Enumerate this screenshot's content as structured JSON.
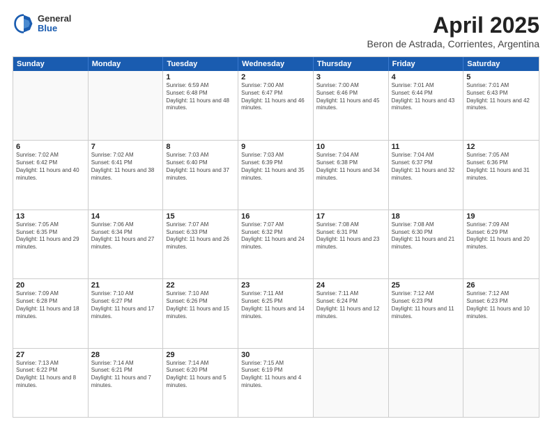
{
  "header": {
    "logo": {
      "general": "General",
      "blue": "Blue"
    },
    "title": "April 2025",
    "location": "Beron de Astrada, Corrientes, Argentina"
  },
  "calendar": {
    "days_of_week": [
      "Sunday",
      "Monday",
      "Tuesday",
      "Wednesday",
      "Thursday",
      "Friday",
      "Saturday"
    ],
    "weeks": [
      [
        {
          "day": "",
          "empty": true
        },
        {
          "day": "",
          "empty": true
        },
        {
          "day": "1",
          "sunrise": "Sunrise: 6:59 AM",
          "sunset": "Sunset: 6:48 PM",
          "daylight": "Daylight: 11 hours and 48 minutes."
        },
        {
          "day": "2",
          "sunrise": "Sunrise: 7:00 AM",
          "sunset": "Sunset: 6:47 PM",
          "daylight": "Daylight: 11 hours and 46 minutes."
        },
        {
          "day": "3",
          "sunrise": "Sunrise: 7:00 AM",
          "sunset": "Sunset: 6:46 PM",
          "daylight": "Daylight: 11 hours and 45 minutes."
        },
        {
          "day": "4",
          "sunrise": "Sunrise: 7:01 AM",
          "sunset": "Sunset: 6:44 PM",
          "daylight": "Daylight: 11 hours and 43 minutes."
        },
        {
          "day": "5",
          "sunrise": "Sunrise: 7:01 AM",
          "sunset": "Sunset: 6:43 PM",
          "daylight": "Daylight: 11 hours and 42 minutes."
        }
      ],
      [
        {
          "day": "6",
          "sunrise": "Sunrise: 7:02 AM",
          "sunset": "Sunset: 6:42 PM",
          "daylight": "Daylight: 11 hours and 40 minutes."
        },
        {
          "day": "7",
          "sunrise": "Sunrise: 7:02 AM",
          "sunset": "Sunset: 6:41 PM",
          "daylight": "Daylight: 11 hours and 38 minutes."
        },
        {
          "day": "8",
          "sunrise": "Sunrise: 7:03 AM",
          "sunset": "Sunset: 6:40 PM",
          "daylight": "Daylight: 11 hours and 37 minutes."
        },
        {
          "day": "9",
          "sunrise": "Sunrise: 7:03 AM",
          "sunset": "Sunset: 6:39 PM",
          "daylight": "Daylight: 11 hours and 35 minutes."
        },
        {
          "day": "10",
          "sunrise": "Sunrise: 7:04 AM",
          "sunset": "Sunset: 6:38 PM",
          "daylight": "Daylight: 11 hours and 34 minutes."
        },
        {
          "day": "11",
          "sunrise": "Sunrise: 7:04 AM",
          "sunset": "Sunset: 6:37 PM",
          "daylight": "Daylight: 11 hours and 32 minutes."
        },
        {
          "day": "12",
          "sunrise": "Sunrise: 7:05 AM",
          "sunset": "Sunset: 6:36 PM",
          "daylight": "Daylight: 11 hours and 31 minutes."
        }
      ],
      [
        {
          "day": "13",
          "sunrise": "Sunrise: 7:05 AM",
          "sunset": "Sunset: 6:35 PM",
          "daylight": "Daylight: 11 hours and 29 minutes."
        },
        {
          "day": "14",
          "sunrise": "Sunrise: 7:06 AM",
          "sunset": "Sunset: 6:34 PM",
          "daylight": "Daylight: 11 hours and 27 minutes."
        },
        {
          "day": "15",
          "sunrise": "Sunrise: 7:07 AM",
          "sunset": "Sunset: 6:33 PM",
          "daylight": "Daylight: 11 hours and 26 minutes."
        },
        {
          "day": "16",
          "sunrise": "Sunrise: 7:07 AM",
          "sunset": "Sunset: 6:32 PM",
          "daylight": "Daylight: 11 hours and 24 minutes."
        },
        {
          "day": "17",
          "sunrise": "Sunrise: 7:08 AM",
          "sunset": "Sunset: 6:31 PM",
          "daylight": "Daylight: 11 hours and 23 minutes."
        },
        {
          "day": "18",
          "sunrise": "Sunrise: 7:08 AM",
          "sunset": "Sunset: 6:30 PM",
          "daylight": "Daylight: 11 hours and 21 minutes."
        },
        {
          "day": "19",
          "sunrise": "Sunrise: 7:09 AM",
          "sunset": "Sunset: 6:29 PM",
          "daylight": "Daylight: 11 hours and 20 minutes."
        }
      ],
      [
        {
          "day": "20",
          "sunrise": "Sunrise: 7:09 AM",
          "sunset": "Sunset: 6:28 PM",
          "daylight": "Daylight: 11 hours and 18 minutes."
        },
        {
          "day": "21",
          "sunrise": "Sunrise: 7:10 AM",
          "sunset": "Sunset: 6:27 PM",
          "daylight": "Daylight: 11 hours and 17 minutes."
        },
        {
          "day": "22",
          "sunrise": "Sunrise: 7:10 AM",
          "sunset": "Sunset: 6:26 PM",
          "daylight": "Daylight: 11 hours and 15 minutes."
        },
        {
          "day": "23",
          "sunrise": "Sunrise: 7:11 AM",
          "sunset": "Sunset: 6:25 PM",
          "daylight": "Daylight: 11 hours and 14 minutes."
        },
        {
          "day": "24",
          "sunrise": "Sunrise: 7:11 AM",
          "sunset": "Sunset: 6:24 PM",
          "daylight": "Daylight: 11 hours and 12 minutes."
        },
        {
          "day": "25",
          "sunrise": "Sunrise: 7:12 AM",
          "sunset": "Sunset: 6:23 PM",
          "daylight": "Daylight: 11 hours and 11 minutes."
        },
        {
          "day": "26",
          "sunrise": "Sunrise: 7:12 AM",
          "sunset": "Sunset: 6:23 PM",
          "daylight": "Daylight: 11 hours and 10 minutes."
        }
      ],
      [
        {
          "day": "27",
          "sunrise": "Sunrise: 7:13 AM",
          "sunset": "Sunset: 6:22 PM",
          "daylight": "Daylight: 11 hours and 8 minutes."
        },
        {
          "day": "28",
          "sunrise": "Sunrise: 7:14 AM",
          "sunset": "Sunset: 6:21 PM",
          "daylight": "Daylight: 11 hours and 7 minutes."
        },
        {
          "day": "29",
          "sunrise": "Sunrise: 7:14 AM",
          "sunset": "Sunset: 6:20 PM",
          "daylight": "Daylight: 11 hours and 5 minutes."
        },
        {
          "day": "30",
          "sunrise": "Sunrise: 7:15 AM",
          "sunset": "Sunset: 6:19 PM",
          "daylight": "Daylight: 11 hours and 4 minutes."
        },
        {
          "day": "",
          "empty": true
        },
        {
          "day": "",
          "empty": true
        },
        {
          "day": "",
          "empty": true
        }
      ]
    ]
  }
}
